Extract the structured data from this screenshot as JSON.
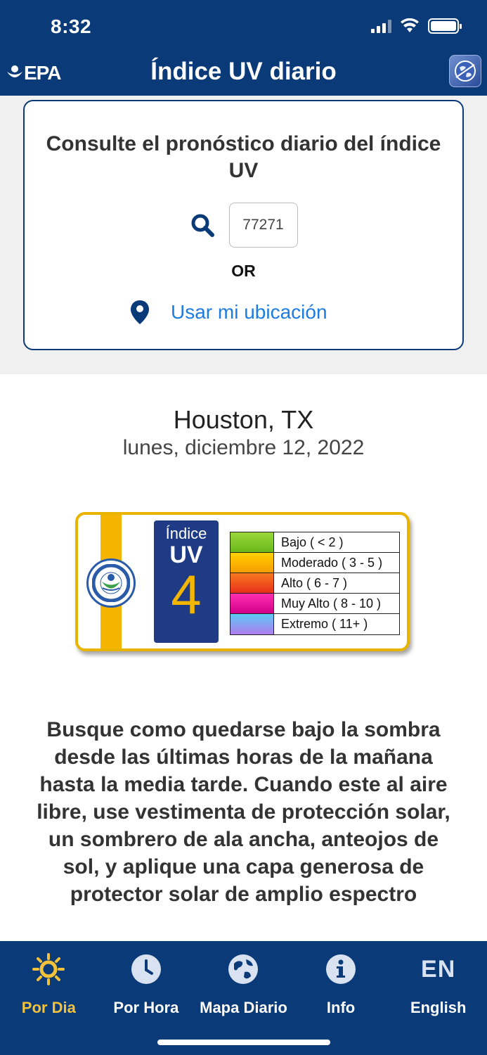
{
  "status": {
    "time": "8:32"
  },
  "header": {
    "logo": "EPA",
    "title": "Índice UV diario",
    "globe_icon": "globe-icon"
  },
  "search": {
    "heading": "Consulte el pronóstico diario del índice UV",
    "zip_value": "77271",
    "or_label": "OR",
    "location_label": "Usar mi ubicación"
  },
  "forecast": {
    "city": "Houston, TX",
    "date": "lunes, diciembre 12, 2022",
    "uv_badge": {
      "indice_label": "Índice",
      "uv_label": "UV",
      "value": "4",
      "scale": [
        {
          "label": "Bajo ( < 2 )",
          "color": "#7cc526"
        },
        {
          "label": "Moderado  ( 3 - 5 )",
          "color": "#f7b500"
        },
        {
          "label": "Alto  ( 6 - 7 )",
          "color": "#f0541e"
        },
        {
          "label": "Muy Alto  ( 8 - 10 )",
          "color": "#e6198a"
        },
        {
          "label": "Extremo  ( 11+ )",
          "color": "#8a8ff0"
        }
      ]
    },
    "advice": "Busque como quedarse bajo la sombra desde las últimas horas de la mañana hasta la media tarde. Cuando este al aire libre, use vestimenta de protección solar, un sombrero de ala ancha, anteojos de sol, y aplique una capa generosa de protector solar de amplio espectro"
  },
  "tabs": [
    {
      "label": "Por Dia",
      "icon": "sun-icon",
      "active": true
    },
    {
      "label": "Por Hora",
      "icon": "clock-icon",
      "active": false
    },
    {
      "label": "Mapa Diario",
      "icon": "globe-icon",
      "active": false
    },
    {
      "label": "Info",
      "icon": "info-icon",
      "active": false
    },
    {
      "label": "English",
      "icon_text": "EN",
      "active": false
    }
  ],
  "colors": {
    "brand_blue": "#0a3a78",
    "active_tab": "#f4c13b",
    "link": "#1d7ce0",
    "uv_gold": "#f2b600"
  }
}
